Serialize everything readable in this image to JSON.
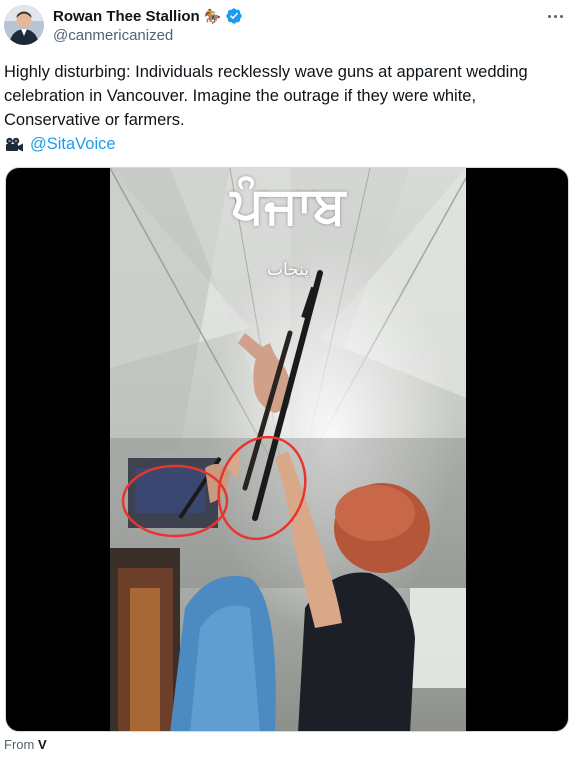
{
  "author": {
    "display_name": "Rowan Thee Stallion",
    "name_emoji": "🏇",
    "handle": "@canmericanized",
    "verified": true,
    "verified_color": "#1d9bf0"
  },
  "tweet": {
    "text": "Highly disturbing: Individuals recklessly wave guns at apparent wedding celebration in Vancouver. Imagine the outrage if they were white, Conservative or farmers.",
    "credit_icon": "camera-icon",
    "mention": "@SitaVoice",
    "link_color": "#1d9bf0"
  },
  "media": {
    "overlay_title": "ਪੰਜਾਬ",
    "overlay_subtitle": "پنجاب",
    "annotation_color": "#e8352f"
  },
  "footer": {
    "from_prefix": "From",
    "from_source": "V"
  }
}
